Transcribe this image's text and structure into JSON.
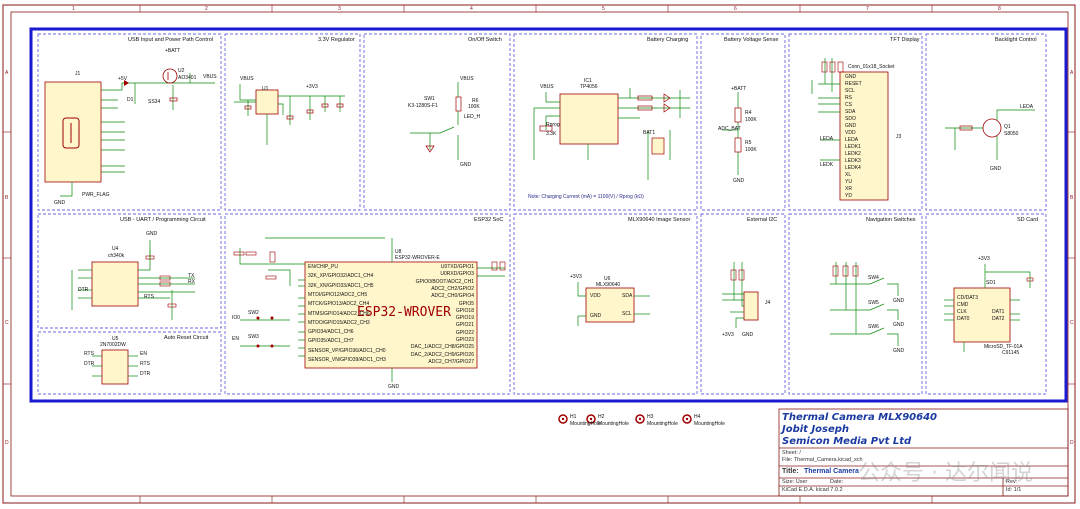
{
  "sheet": {
    "col_labels": [
      "1",
      "2",
      "3",
      "4",
      "5",
      "6",
      "7",
      "8"
    ],
    "row_labels": [
      "A",
      "B",
      "C",
      "D"
    ]
  },
  "sections": {
    "usb_power": "USB Input and Power Path Control",
    "regulator": "3.3V Regulator",
    "onoff": "On/Off Switch",
    "charging": "Battery Charging",
    "bat_sense": "Battery Voltage Sense",
    "tft": "TFT Display",
    "backlight": "Backlight Control",
    "uart": "USB - UART / Programming Circuit",
    "esp32": "ESP32 SoC",
    "mlx": "MLX90640 Image Sensor",
    "i2c": "External I2C",
    "nav": "Navigation Switches",
    "sd": "SD Card",
    "autoreset": "Auto Reset Circuit"
  },
  "components": {
    "j1": "J1",
    "u2": "U2",
    "u2_part": "AO3401",
    "d1": "D1",
    "d1_part": "SS34",
    "u1": "U1",
    "sw1": "SW1",
    "sw1_part": "K3-1280S-F1",
    "r6": "R6",
    "r6_val": "100K",
    "led_h": "LED_H",
    "ic1": "IC1",
    "ic1_part": "TP4056",
    "rprog": "Rprog",
    "rprog_val": "3.3K",
    "bat1": "BAT1",
    "r4": "R4",
    "r4_val": "100K",
    "r5": "R5",
    "r5_val": "100K",
    "adc_bat": "ADC_BAT",
    "j3": "J3",
    "j3_part": "Conn_01x18_Socket",
    "q1": "Q1",
    "q1_part": "S8050",
    "u4": "U4",
    "u4_part": "ch340k",
    "u5": "U5",
    "u5_part": "2N7002DW",
    "u8": "U8",
    "u8_part": "ESP32-WROVER-E",
    "u8_body": "ESP32-WROVER",
    "u6": "U6",
    "u6_part": "MLX90640",
    "j4": "J4",
    "sd1": "SD1",
    "sd1_part": "MicroSD_TF-01A",
    "sd1_part2": "C91145",
    "sw4": "SW4",
    "sw5": "SW5",
    "sw6": "SW6",
    "sw2": "SW2",
    "sw3": "SW3"
  },
  "nets": {
    "vbus": "VBUS",
    "vbat": "+BATT",
    "v5": "+5V",
    "v33": "+3V3",
    "gnd": "GND",
    "pwr_flag": "PWR_FLAG",
    "leda": "LEDA",
    "ledk": "LEDK",
    "io0": "IO0",
    "en": "EN",
    "rts": "RTS",
    "dtr": "DTR",
    "tx": "TX",
    "rx": "RX"
  },
  "tft_pins": [
    "GND",
    "RESET",
    "SCL",
    "RS",
    "CS",
    "SDA",
    "SDO",
    "GND",
    "VDD",
    "LEDA",
    "LEDK1",
    "LEDK2",
    "LEDK3",
    "LEDK4",
    "XL",
    "YU",
    "XR",
    "YD"
  ],
  "esp_left_pins": [
    "EN/CHIP_PU",
    "32K_XP/GPIO32/ADC1_CH4",
    "32K_XN/GPIO33/ADC1_CH5",
    "MTDI/GPIO12/ADC2_CH5",
    "MTCK/GPIO13/ADC2_CH4",
    "MTMS/GPIO14/ADC2_CH6",
    "MTDO/GPIO15/ADC2_CH3",
    "GPIO34/ADC1_CH6",
    "GPIO35/ADC1_CH7",
    "SENSOR_VP/GPIO36/ADC1_CH0",
    "SENSOR_VN/GPIO39/ADC1_CH3"
  ],
  "esp_right_pins": [
    "U0TXD/GPIO1",
    "U0RXD/GPIO3",
    "GPIO0/BOOT/ADC2_CH1",
    "ADC2_CH2/GPIO2",
    "ADC2_CH0/GPIO4",
    "GPIO5",
    "GPIO18",
    "GPIO19",
    "GPIO21",
    "GPIO22",
    "GPIO23",
    "DAC_1/ADC2_CH8/GPIO25",
    "DAC_2/ADC2_CH9/GPIO26",
    "ADC2_CH7/GPIO27"
  ],
  "mlx_pins": {
    "vdd": "VDD",
    "gnd": "GND",
    "sda": "SDA",
    "scl": "SCL"
  },
  "sd_pins": [
    "CD/DAT3",
    "CMD",
    "CLK",
    "DAT0",
    "DAT1",
    "DAT2"
  ],
  "charging_note": "Note: Charging Current (mA) = 1100(V) / Rprog (kΩ)",
  "mounting_holes": [
    {
      "ref": "H1",
      "label": "MountingHole"
    },
    {
      "ref": "H2",
      "label": "MountingHole"
    },
    {
      "ref": "H3",
      "label": "MountingHole"
    },
    {
      "ref": "H4",
      "label": "MountingHole"
    }
  ],
  "title_block": {
    "line1": "Thermal Camera MLX90640",
    "line2": "Jobit Joseph",
    "line3": "Semicon Media Pvt Ltd",
    "sheet_label": "Sheet: /",
    "file_label": "File: Thermal_Camera.kicad_sch",
    "title_label": "Title:",
    "title_value": "Thermal Camera",
    "size_label": "Size: User",
    "date_label": "Date:",
    "rev_label": "Rev:",
    "kicad_label": "KiCad E.D.A.  kicad 7.0.2",
    "id_label": "Id: 1/1"
  },
  "watermark": "公众号 · 达尔闻说",
  "colors": {
    "border": "#1a1ad0",
    "frame": "#8a1a1a",
    "wire": "#0a8a0a",
    "component": "#a00000",
    "body_fill": "#fff6cc",
    "label": "#111111"
  }
}
